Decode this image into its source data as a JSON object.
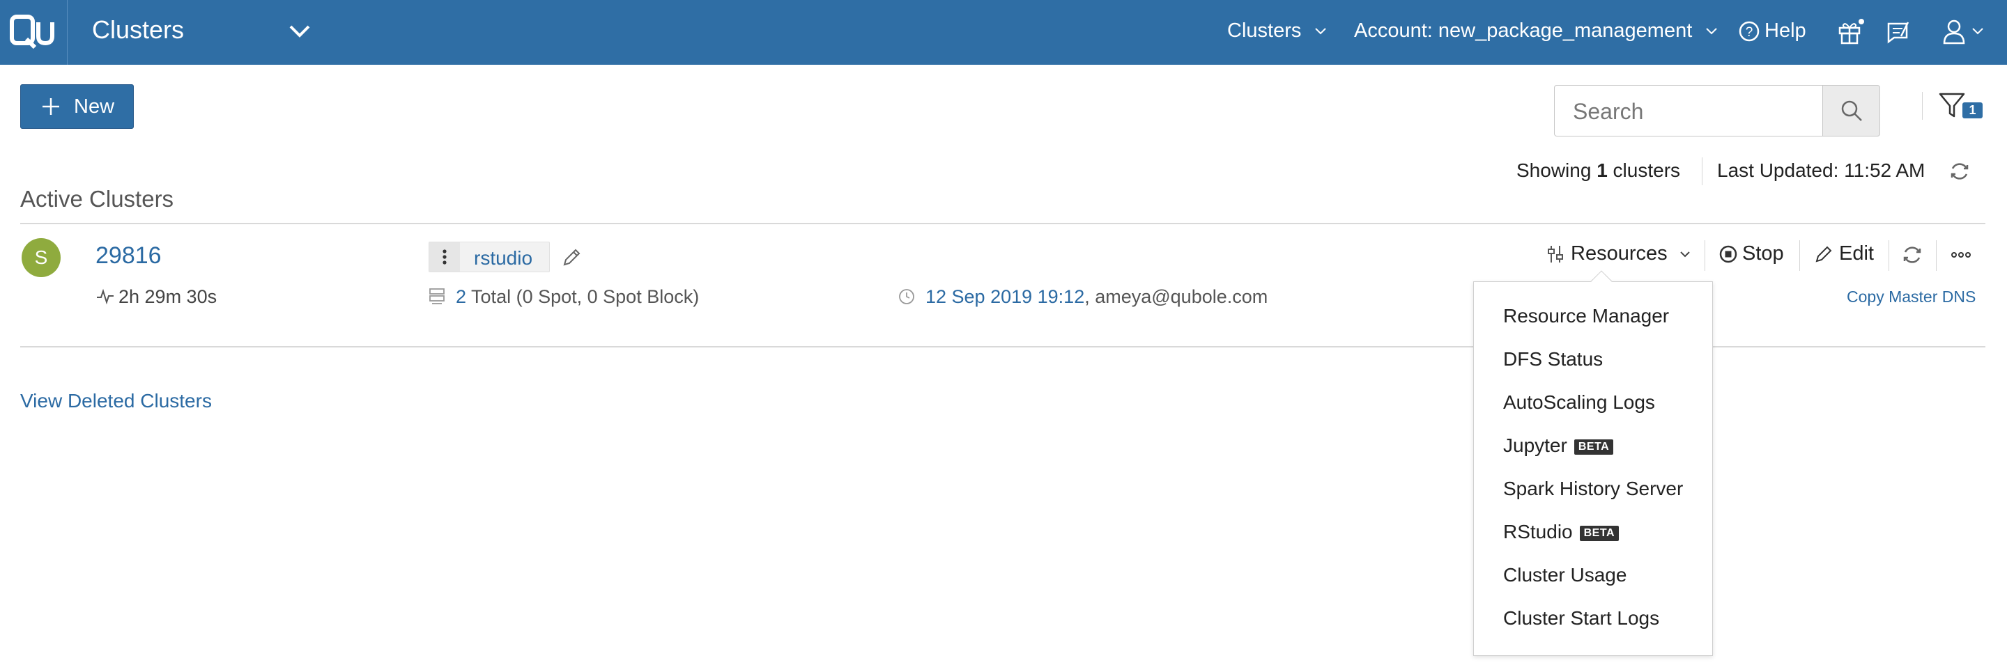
{
  "header": {
    "app_title": "Clusters",
    "nav_clusters": "Clusters",
    "account": "Account: new_package_management",
    "help": "Help",
    "brand_color": "#2f6ea5"
  },
  "toolbar": {
    "new_label": "New",
    "search_placeholder": "Search",
    "filter_count": "1"
  },
  "status": {
    "showing_prefix": "Showing ",
    "showing_count": "1",
    "showing_suffix": " clusters",
    "last_updated": "Last Updated: 11:52 AM"
  },
  "section_title": "Active Clusters",
  "cluster": {
    "avatar_letter": "S",
    "avatar_color": "#8fab3e",
    "id": "29816",
    "uptime": "2h 29m 30s",
    "label": "rstudio",
    "nodes_count": "2",
    "nodes_detail": " Total (0 Spot, 0 Spot Block)",
    "started_at": "12 Sep 2019 19:12",
    "started_by": ", ameya@qubole.com",
    "copy_dns": "Copy Master DNS"
  },
  "actions": {
    "resources": "Resources",
    "stop": "Stop",
    "edit": "Edit"
  },
  "resources_menu": [
    {
      "label": "Resource Manager",
      "badge": ""
    },
    {
      "label": "DFS Status",
      "badge": ""
    },
    {
      "label": "AutoScaling Logs",
      "badge": ""
    },
    {
      "label": "Jupyter",
      "badge": "BETA"
    },
    {
      "label": "Spark History Server",
      "badge": ""
    },
    {
      "label": "RStudio",
      "badge": "BETA"
    },
    {
      "label": "Cluster Usage",
      "badge": ""
    },
    {
      "label": "Cluster Start Logs",
      "badge": ""
    }
  ],
  "view_deleted": "View Deleted Clusters"
}
